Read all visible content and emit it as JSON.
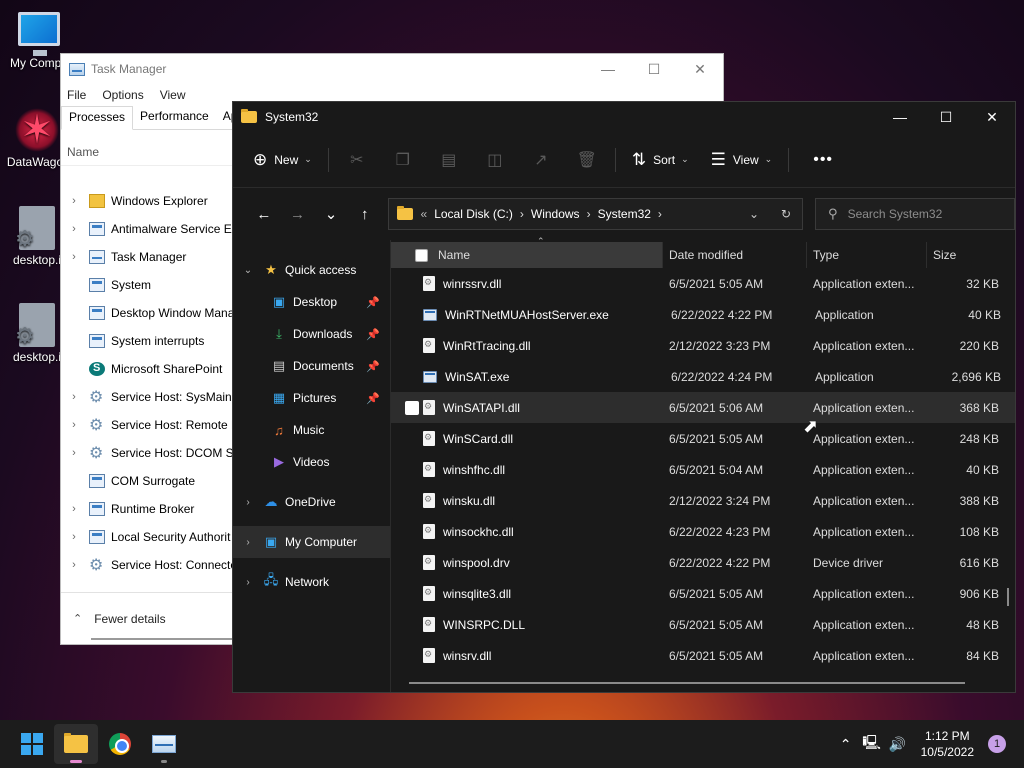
{
  "desktop": {
    "icons": [
      {
        "label": "My Compu",
        "icon": "monitor-icon"
      },
      {
        "label": "DataWagor",
        "icon": "app-shortcut-icon"
      },
      {
        "label": "desktop.i",
        "icon": "settings-file-icon"
      },
      {
        "label": "desktop.i",
        "icon": "settings-file-icon"
      }
    ]
  },
  "taskmanager": {
    "title": "Task Manager",
    "menu": [
      "File",
      "Options",
      "View"
    ],
    "tabs": [
      "Processes",
      "Performance",
      "App"
    ],
    "column_name": "Name",
    "processes": [
      {
        "name": "Windows Explorer",
        "expandable": true,
        "icon": "folder"
      },
      {
        "name": "Antimalware Service Ex",
        "expandable": true,
        "icon": "win"
      },
      {
        "name": "Task Manager",
        "expandable": true,
        "icon": "chart"
      },
      {
        "name": "System",
        "expandable": false,
        "icon": "win"
      },
      {
        "name": "Desktop Window Mana",
        "expandable": false,
        "icon": "win"
      },
      {
        "name": "System interrupts",
        "expandable": false,
        "icon": "win"
      },
      {
        "name": "Microsoft SharePoint",
        "expandable": false,
        "icon": "sp"
      },
      {
        "name": "Service Host: SysMain",
        "expandable": true,
        "icon": "gear"
      },
      {
        "name": "Service Host: Remote P",
        "expandable": true,
        "icon": "gear"
      },
      {
        "name": "Service Host: DCOM Se",
        "expandable": true,
        "icon": "gear"
      },
      {
        "name": "COM Surrogate",
        "expandable": false,
        "icon": "win"
      },
      {
        "name": "Runtime Broker",
        "expandable": true,
        "icon": "win"
      },
      {
        "name": "Local Security Authorit",
        "expandable": true,
        "icon": "win"
      },
      {
        "name": "Service Host: Connecte",
        "expandable": true,
        "icon": "gear"
      }
    ],
    "fewer_details": "Fewer details"
  },
  "explorer": {
    "title": "System32",
    "toolbar": {
      "new_label": "New",
      "sort_label": "Sort",
      "view_label": "View",
      "more_label": "•••"
    },
    "address": {
      "prefix": "«",
      "crumbs": [
        "Local Disk (C:)",
        "Windows",
        "System32"
      ]
    },
    "search_placeholder": "Search System32",
    "nav": {
      "quick_access": "Quick access",
      "pinned": [
        {
          "label": "Desktop",
          "icon": "desktop-icon",
          "pinned": true
        },
        {
          "label": "Downloads",
          "icon": "downloads-icon",
          "pinned": true
        },
        {
          "label": "Documents",
          "icon": "documents-icon",
          "pinned": true
        },
        {
          "label": "Pictures",
          "icon": "pictures-icon",
          "pinned": true
        },
        {
          "label": "Music",
          "icon": "music-icon",
          "pinned": false
        },
        {
          "label": "Videos",
          "icon": "videos-icon",
          "pinned": false
        }
      ],
      "onedrive": "OneDrive",
      "my_computer": "My Computer",
      "network": "Network"
    },
    "columns": {
      "name": "Name",
      "date": "Date modified",
      "type": "Type",
      "size": "Size"
    },
    "files": [
      {
        "name": "winrssrv.dll",
        "date": "6/5/2021 5:05 AM",
        "type": "Application exten...",
        "size": "32 KB",
        "kind": "dll"
      },
      {
        "name": "WinRTNetMUAHostServer.exe",
        "date": "6/22/2022 4:22 PM",
        "type": "Application",
        "size": "40 KB",
        "kind": "exe"
      },
      {
        "name": "WinRtTracing.dll",
        "date": "2/12/2022 3:23 PM",
        "type": "Application exten...",
        "size": "220 KB",
        "kind": "dll"
      },
      {
        "name": "WinSAT.exe",
        "date": "6/22/2022 4:24 PM",
        "type": "Application",
        "size": "2,696 KB",
        "kind": "exe"
      },
      {
        "name": "WinSATAPI.dll",
        "date": "6/5/2021 5:06 AM",
        "type": "Application exten...",
        "size": "368 KB",
        "kind": "dll"
      },
      {
        "name": "WinSCard.dll",
        "date": "6/5/2021 5:05 AM",
        "type": "Application exten...",
        "size": "248 KB",
        "kind": "dll"
      },
      {
        "name": "winshfhc.dll",
        "date": "6/5/2021 5:04 AM",
        "type": "Application exten...",
        "size": "40 KB",
        "kind": "dll"
      },
      {
        "name": "winsku.dll",
        "date": "2/12/2022 3:24 PM",
        "type": "Application exten...",
        "size": "388 KB",
        "kind": "dll"
      },
      {
        "name": "winsockhc.dll",
        "date": "6/22/2022 4:23 PM",
        "type": "Application exten...",
        "size": "108 KB",
        "kind": "dll"
      },
      {
        "name": "winspool.drv",
        "date": "6/22/2022 4:22 PM",
        "type": "Device driver",
        "size": "616 KB",
        "kind": "dll"
      },
      {
        "name": "winsqlite3.dll",
        "date": "6/5/2021 5:05 AM",
        "type": "Application exten...",
        "size": "906 KB",
        "kind": "dll"
      },
      {
        "name": "WINSRPC.DLL",
        "date": "6/5/2021 5:05 AM",
        "type": "Application exten...",
        "size": "48 KB",
        "kind": "dll"
      },
      {
        "name": "winsrv.dll",
        "date": "6/5/2021 5:05 AM",
        "type": "Application exten...",
        "size": "84 KB",
        "kind": "dll"
      }
    ],
    "hovered_file": "WinSATAPI.dll"
  },
  "taskbar": {
    "apps": [
      {
        "name": "start",
        "icon": "windows-logo-icon"
      },
      {
        "name": "file-explorer",
        "icon": "folder-icon"
      },
      {
        "name": "chrome",
        "icon": "chrome-icon"
      },
      {
        "name": "task-manager",
        "icon": "task-manager-icon"
      }
    ],
    "time": "1:12 PM",
    "date": "10/5/2022",
    "notification_count": "1"
  },
  "colors": {
    "explorer_bg": "#191919",
    "taskbar_bg": "#1c1c1c",
    "accent": "#3aa8f0",
    "folder": "#f5c244"
  }
}
